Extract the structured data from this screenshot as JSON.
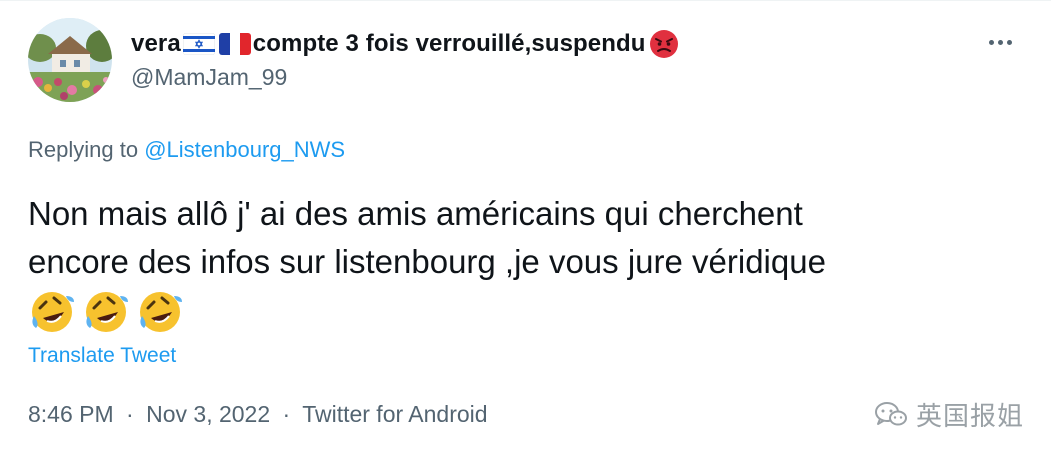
{
  "tweet": {
    "author": {
      "display_name_prefix": "vera",
      "flags": [
        "israel-flag",
        "france-flag"
      ],
      "display_name_suffix": "compte 3 fois verrouillé,suspendu",
      "trailing_emoji": "angry-face-emoji",
      "handle": "@MamJam_99"
    },
    "replying_to_label": "Replying to",
    "replying_to_handle": "@Listenbourg_NWS",
    "text_line_1": "Non mais allô j' ai des amis américains qui cherchent",
    "text_line_2": "encore des infos sur listenbourg ,je vous jure véridique",
    "emojis": [
      "rolling-on-floor-laughing-emoji",
      "rolling-on-floor-laughing-emoji",
      "rolling-on-floor-laughing-emoji"
    ],
    "translate_label": "Translate Tweet",
    "time": "8:46 PM",
    "separator": "·",
    "date": "Nov 3, 2022",
    "source": "Twitter for Android"
  },
  "watermark": {
    "icon": "wechat-icon",
    "text": "英国报姐"
  },
  "colors": {
    "text_primary": "#0f1419",
    "text_secondary": "#536471",
    "link": "#1d9bf0",
    "watermark": "#9aa1a6"
  }
}
